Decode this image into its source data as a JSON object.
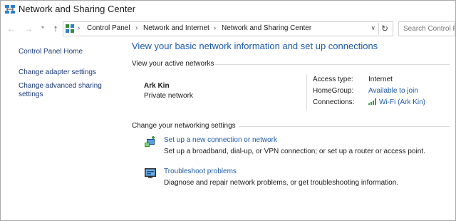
{
  "window": {
    "title": "Network and Sharing Center"
  },
  "address": {
    "breadcrumbs": [
      "Control Panel",
      "Network and Internet",
      "Network and Sharing Center"
    ],
    "search_placeholder": "Search Control P"
  },
  "sidebar": {
    "items": [
      {
        "label": "Control Panel Home"
      },
      {
        "label": "Change adapter settings"
      },
      {
        "label": "Change advanced sharing settings",
        "line1": "Change advanced sharing",
        "line2": "settings"
      }
    ]
  },
  "main": {
    "heading": "View your basic network information and set up connections",
    "active_networks_label": "View your active networks",
    "network": {
      "name": "Ark Kin",
      "type": "Private network",
      "access_type_label": "Access type:",
      "access_type_value": "Internet",
      "homegroup_label": "HomeGroup:",
      "homegroup_value": "Available to join",
      "connections_label": "Connections:",
      "connections_value": "Wi-Fi (Ark Kin)"
    },
    "settings_label": "Change your networking settings",
    "tasks": [
      {
        "link": "Set up a new connection or network",
        "desc": "Set up a broadband, dial-up, or VPN connection; or set up a router or access point.",
        "icon": "new-connection-icon"
      },
      {
        "link": "Troubleshoot problems",
        "desc": "Diagnose and repair network problems, or get troubleshooting information.",
        "icon": "troubleshoot-icon"
      }
    ]
  },
  "colors": {
    "link": "#1e5aa8",
    "text": "#1a1a1a",
    "rule": "#dcdcdc"
  }
}
